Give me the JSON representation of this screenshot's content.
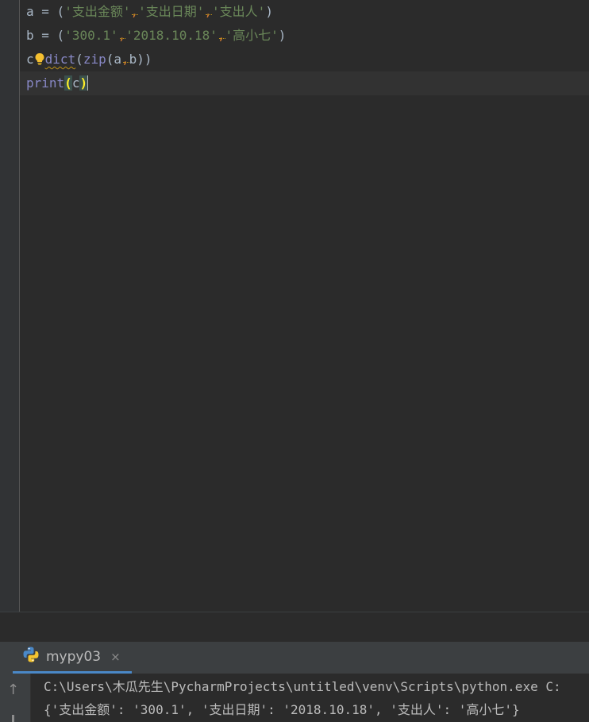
{
  "editor": {
    "line1": {
      "var": "a",
      "eq": " = ",
      "open": "(",
      "s1": "'支出金额'",
      "s2": "'支出日期'",
      "s3": "'支出人'",
      "close": ")"
    },
    "line2": {
      "var": "b",
      "eq": " = ",
      "open": "(",
      "s1": "'300.1'",
      "s2": "'2018.10.18'",
      "s3": "'高小七'",
      "close": ")"
    },
    "line3": {
      "var": "c",
      "fn": "dict",
      "open": "(",
      "fn2": "zip",
      "open2": "(",
      "arg1": "a",
      "arg2": "b",
      "close": "))"
    },
    "line4": {
      "fn": "print",
      "open": "(",
      "arg": "c",
      "close": ")"
    },
    "comma": ","
  },
  "run_panel": {
    "tab_label": "mypy03",
    "tab_close": "×",
    "console_lines": [
      "C:\\Users\\木瓜先生\\PycharmProjects\\untitled\\venv\\Scripts\\python.exe C:",
      "{'支出金额': '300.1', '支出日期': '2018.10.18', '支出人': '高小七'}"
    ]
  },
  "icons": {
    "intention_bulb": "lightbulb-icon",
    "run_tab": "python-icon",
    "scroll_up": "arrow-up-icon"
  },
  "colors": {
    "editor_bg": "#2b2b2b",
    "string": "#6a8759",
    "builtin": "#8888c6",
    "warning": "#be9117",
    "accent_tab": "#4a88c7"
  }
}
